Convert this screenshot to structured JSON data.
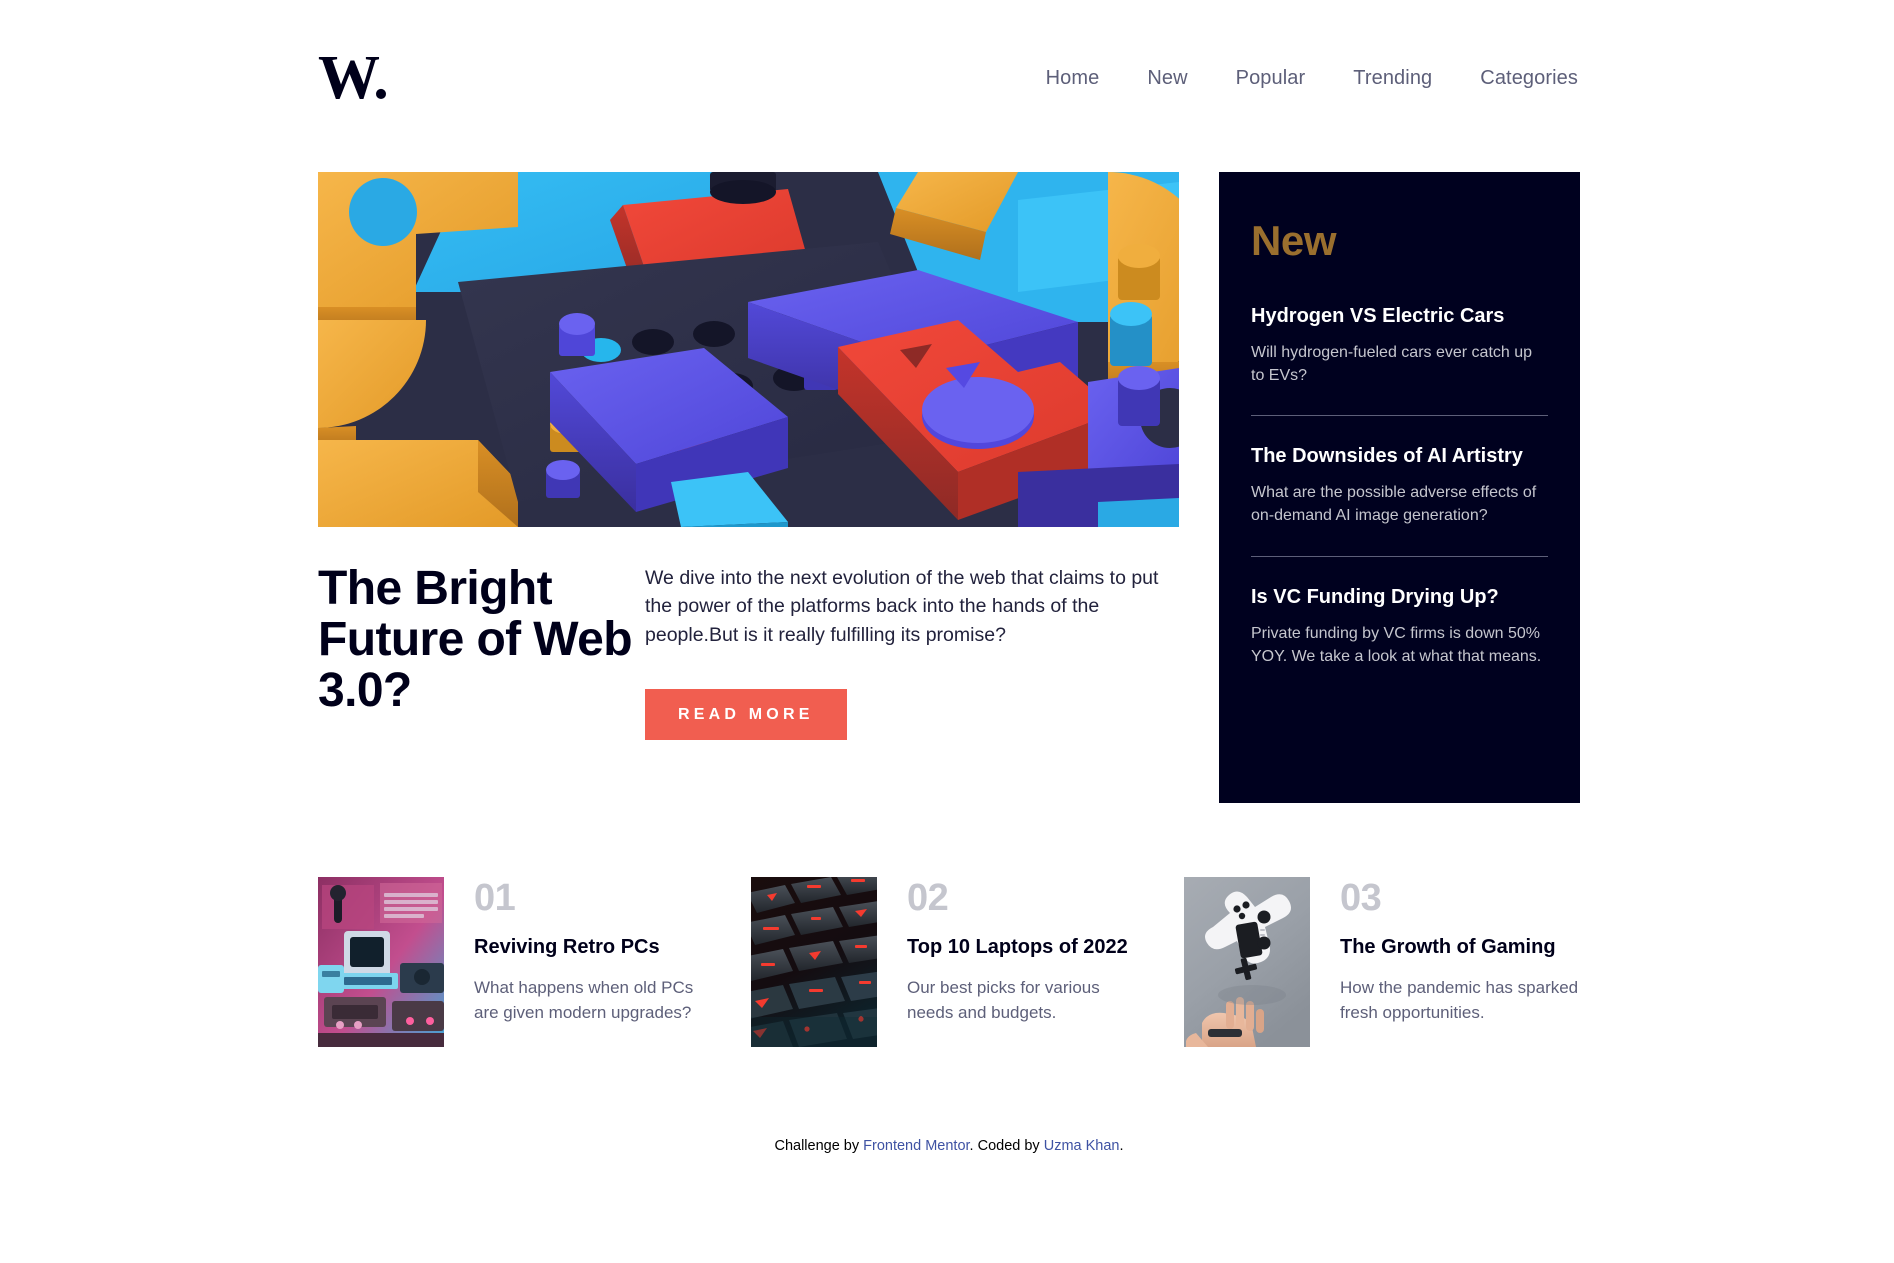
{
  "header": {
    "logo": "W.",
    "nav": [
      {
        "label": "Home"
      },
      {
        "label": "New"
      },
      {
        "label": "Popular"
      },
      {
        "label": "Trending"
      },
      {
        "label": "Categories"
      }
    ]
  },
  "hero": {
    "image_alt": "3d-geometric-blocks-image",
    "title": "The Bright Future of Web 3.0?",
    "description": "We dive into the next evolution of the web that claims to put the power of the platforms back into the hands of the people.But is it really fulfilling its promise?",
    "button_label": "READ MORE",
    "button_color": "#f15e50"
  },
  "new_panel": {
    "title": "New",
    "title_color": "#9a6f2e",
    "background": "#00011f",
    "items": [
      {
        "title": "Hydrogen VS Electric Cars",
        "description": "Will hydrogen-fueled cars ever catch up to EVs?"
      },
      {
        "title": "The Downsides of AI Artistry",
        "description": "What are the possible adverse effects of on-demand AI image generation?"
      },
      {
        "title": "Is VC Funding Drying Up?",
        "description": "Private funding by VC firms is down 50% YOY. We take a look at what that means."
      }
    ]
  },
  "cards": [
    {
      "number": "01",
      "title": "Reviving Retro PCs",
      "description": "What happens when old PCs are given modern upgrades?",
      "thumb": "retro-pc-image"
    },
    {
      "number": "02",
      "title": "Top 10 Laptops of 2022",
      "description": "Our best picks for various needs and budgets.",
      "thumb": "backlit-keyboard-image"
    },
    {
      "number": "03",
      "title": "The Growth of Gaming",
      "description": "How the pandemic has sparked fresh opportunities.",
      "thumb": "game-controller-image"
    }
  ],
  "footer": {
    "prefix": "Challenge by ",
    "link1": "Frontend Mentor",
    "middle": ". Coded by ",
    "link2": "Uzma Khan",
    "suffix": "."
  }
}
